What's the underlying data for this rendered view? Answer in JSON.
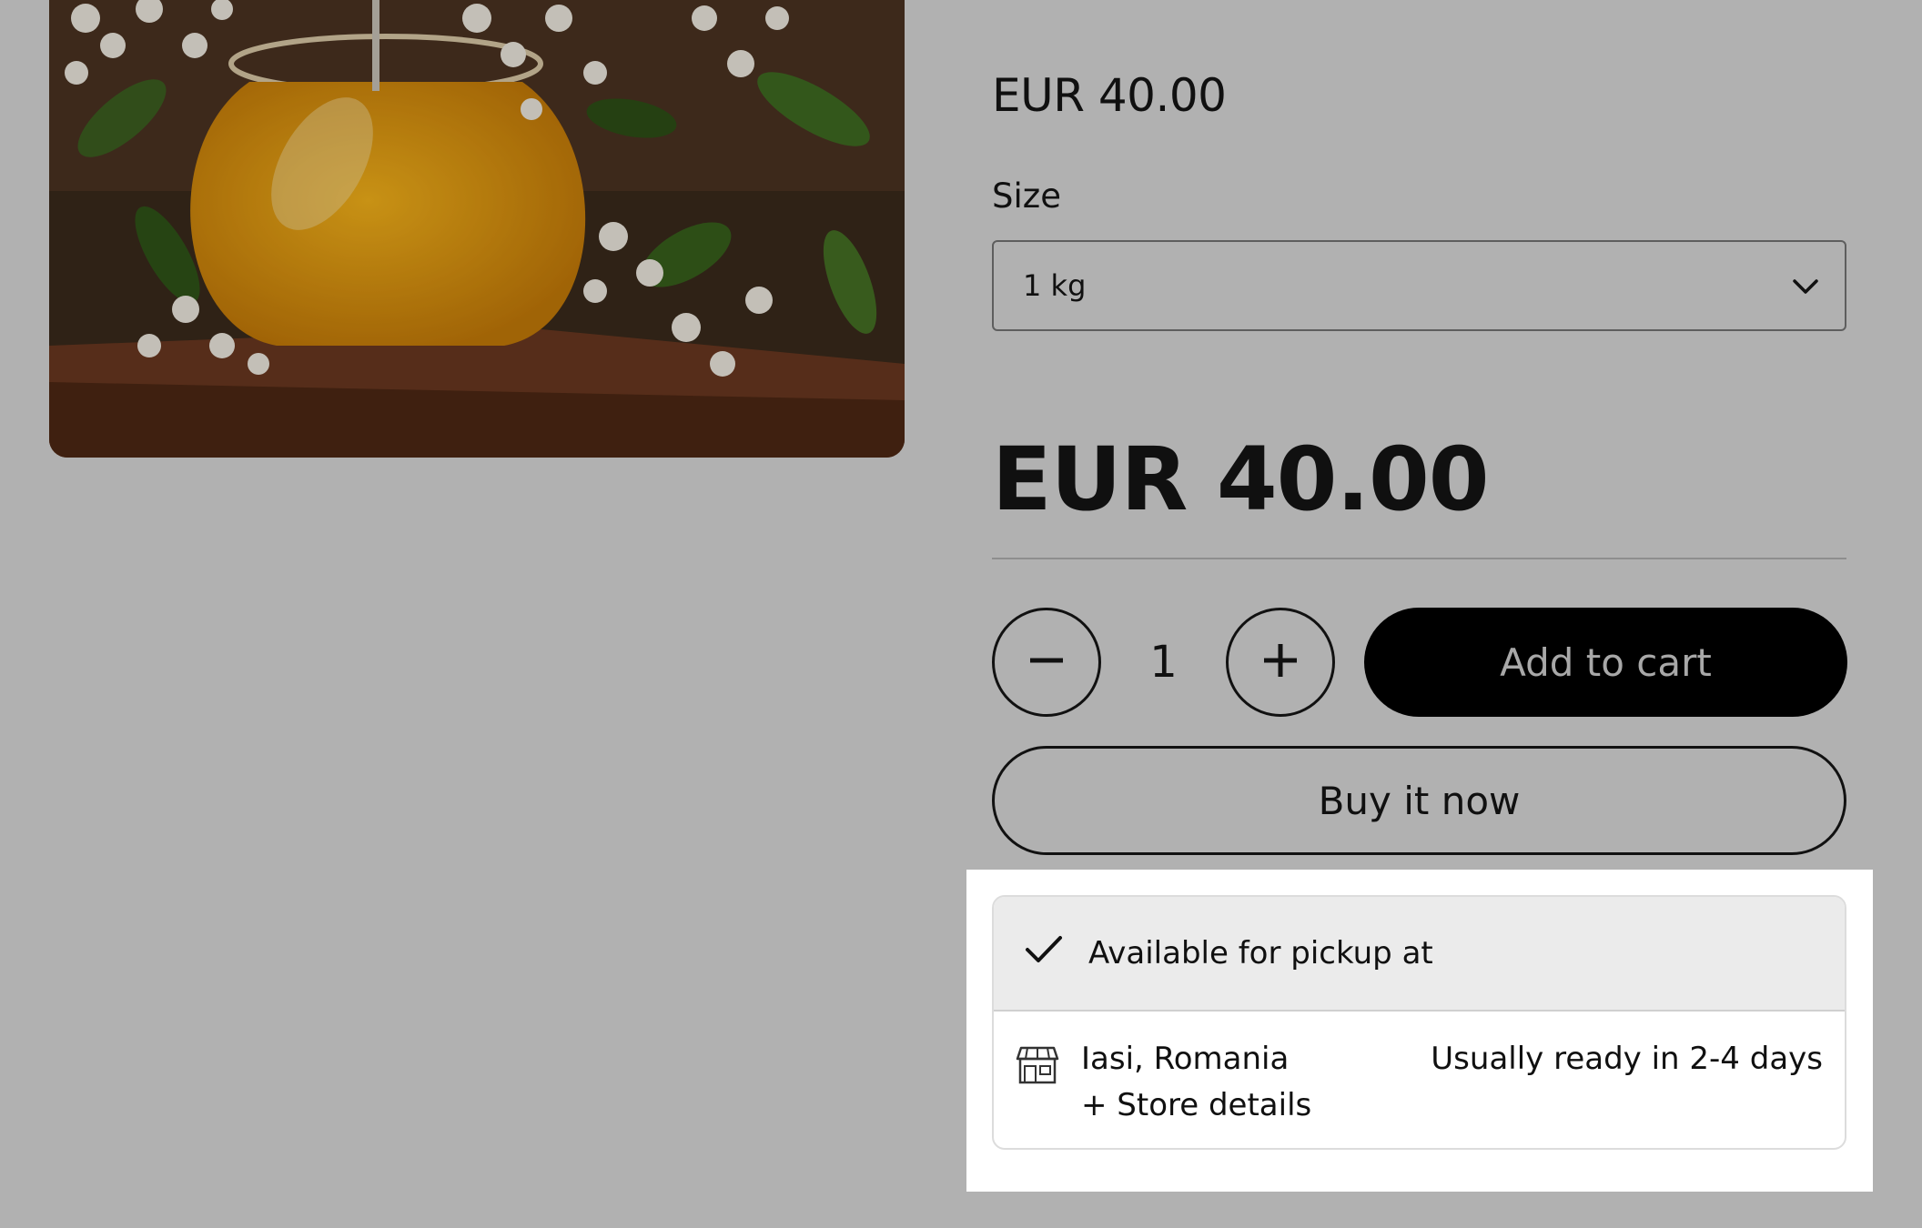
{
  "product": {
    "image_icon": "honey-jar-photo",
    "price_small": "EUR 40.00",
    "price_large": "EUR 40.00"
  },
  "size": {
    "label": "Size",
    "selected": "1 kg",
    "icon": "chevron-down-icon"
  },
  "quantity": {
    "value": "1",
    "minus_icon": "minus-icon",
    "plus_icon": "plus-icon"
  },
  "buttons": {
    "add_to_cart": "Add to cart",
    "buy_now": "Buy it now"
  },
  "pickup": {
    "status": "Available for pickup at",
    "status_icon": "checkmark-icon",
    "store_name": "Iasi, Romania",
    "store_details_link": "+ Store details",
    "ready_time": "Usually ready in 2-4 days",
    "store_icon": "store-icon"
  },
  "colors": {
    "overlay_background": "#b1b1b1",
    "add_to_cart_bg": "#000000",
    "pickup_panel_bg": "#ffffff",
    "pickup_header_bg": "#ebebeb"
  }
}
